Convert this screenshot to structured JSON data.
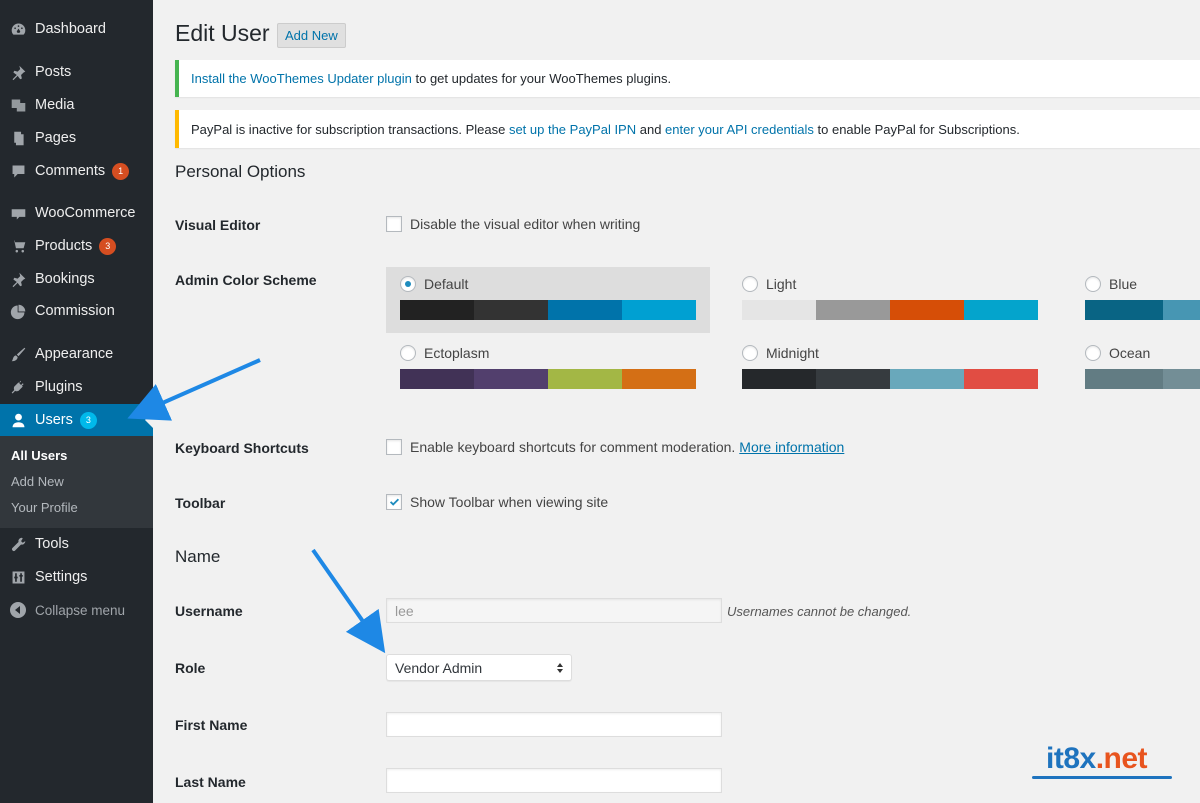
{
  "sidebar": {
    "items": [
      {
        "label": "Dashboard",
        "icon": "dashboard-icon"
      },
      {
        "label": "Posts",
        "icon": "pin-icon"
      },
      {
        "label": "Media",
        "icon": "media-icon"
      },
      {
        "label": "Pages",
        "icon": "pages-icon"
      },
      {
        "label": "Comments",
        "icon": "comment-icon",
        "badge": "1"
      },
      {
        "label": "WooCommerce",
        "icon": "woocommerce-icon"
      },
      {
        "label": "Products",
        "icon": "products-icon",
        "badge": "3"
      },
      {
        "label": "Bookings",
        "icon": "pin-icon"
      },
      {
        "label": "Commission",
        "icon": "pie-chart-icon"
      },
      {
        "label": "Appearance",
        "icon": "paintbrush-icon"
      },
      {
        "label": "Plugins",
        "icon": "plugin-icon"
      },
      {
        "label": "Users",
        "icon": "user-icon",
        "badge": "3"
      },
      {
        "label": "Tools",
        "icon": "wrench-icon"
      },
      {
        "label": "Settings",
        "icon": "settings-icon"
      }
    ],
    "submenu": {
      "all_users": "All Users",
      "add_new": "Add New",
      "your_profile": "Your Profile"
    },
    "collapse": "Collapse menu"
  },
  "header": {
    "title": "Edit User",
    "add_new": "Add New"
  },
  "notices": {
    "updater_link": "Install the WooThemes Updater plugin",
    "updater_text": " to get updates for your WooThemes plugins.",
    "paypal_text1": "PayPal is inactive for subscription transactions. Please ",
    "paypal_link1": "set up the PayPal IPN",
    "paypal_text2": " and ",
    "paypal_link2": "enter your API credentials",
    "paypal_text3": " to enable PayPal for Subscriptions."
  },
  "personal_options": {
    "title": "Personal Options",
    "visual_editor_label": "Visual Editor",
    "visual_editor_text": "Disable the visual editor when writing",
    "visual_editor_checked": false,
    "color_scheme_label": "Admin Color Scheme",
    "schemes": [
      {
        "name": "Default",
        "selected": true,
        "colors": [
          "#222222",
          "#333333",
          "#0073aa",
          "#00a0d2"
        ]
      },
      {
        "name": "Light",
        "selected": false,
        "colors": [
          "#e5e5e5",
          "#999999",
          "#d64e07",
          "#04a4cc"
        ]
      },
      {
        "name": "Blue",
        "selected": false,
        "colors": [
          "#096484",
          "#4796b3",
          "#52accc",
          "#74B6CE"
        ]
      },
      {
        "name": "Ectoplasm",
        "selected": false,
        "colors": [
          "#413256",
          "#523f6d",
          "#a3b745",
          "#d46f15"
        ]
      },
      {
        "name": "Midnight",
        "selected": false,
        "colors": [
          "#25282b",
          "#363b3f",
          "#69a8bb",
          "#e14d43"
        ]
      },
      {
        "name": "Ocean",
        "selected": false,
        "colors": [
          "#627c83",
          "#738e96",
          "#9ebaa0",
          "#aa9d88"
        ]
      }
    ],
    "keyboard_label": "Keyboard Shortcuts",
    "keyboard_text": "Enable keyboard shortcuts for comment moderation.",
    "keyboard_link": "More information",
    "keyboard_checked": false,
    "toolbar_label": "Toolbar",
    "toolbar_text": "Show Toolbar when viewing site",
    "toolbar_checked": true
  },
  "name_section": {
    "title": "Name",
    "username_label": "Username",
    "username_value": "lee",
    "username_note": "Usernames cannot be changed.",
    "role_label": "Role",
    "role_value": "Vendor Admin",
    "first_name_label": "First Name",
    "first_name_value": "",
    "last_name_label": "Last Name",
    "last_name_value": ""
  },
  "watermark": {
    "part1": "it8x",
    "part2": ".net"
  },
  "colors": {
    "sidebar_bg": "#23282d",
    "accent": "#0073aa",
    "badge": "#d54e21",
    "annotation_arrow": "#1e88e5"
  }
}
